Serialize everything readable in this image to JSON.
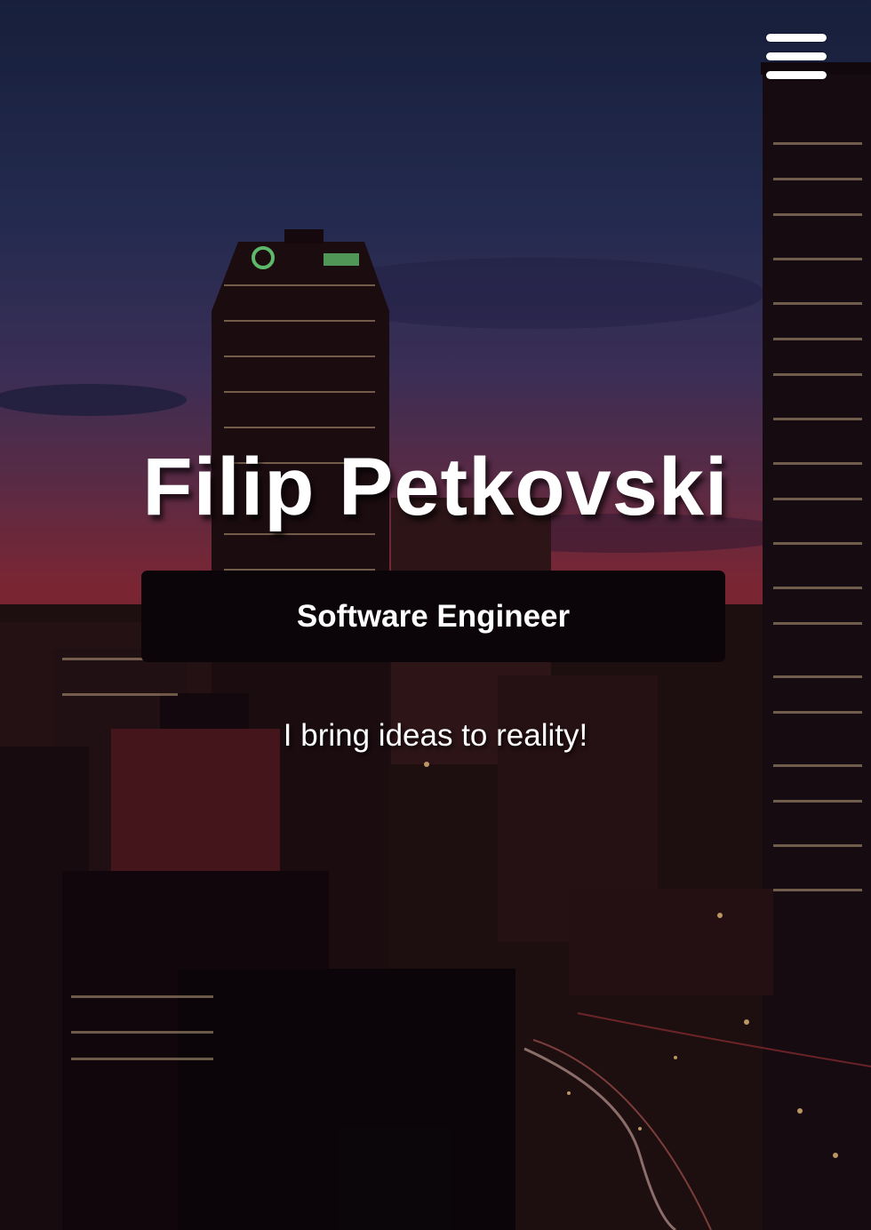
{
  "hero": {
    "name": "Filip Petkovski",
    "role": "Software Engineer",
    "tagline": "I bring ideas to reality!"
  },
  "menu": {
    "icon": "hamburger-menu-icon"
  },
  "colors": {
    "text": "#ffffff",
    "badge_background": "#0b0509",
    "sky_top": "#1c2a4a",
    "sky_glow": "#a8333e"
  }
}
